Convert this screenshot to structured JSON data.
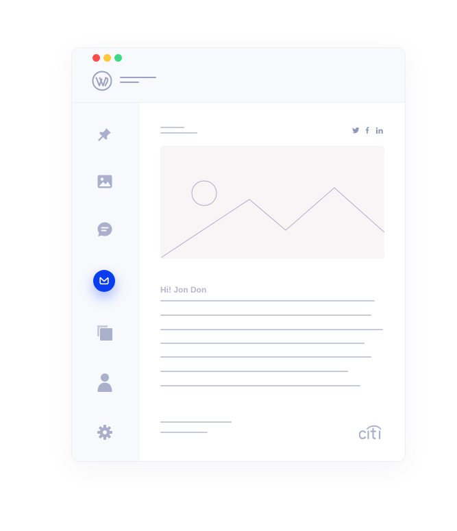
{
  "window": {
    "controls": [
      {
        "name": "close",
        "color": "#ff4d4d"
      },
      {
        "name": "minimize",
        "color": "#ffc83d"
      },
      {
        "name": "maximize",
        "color": "#3ddc84"
      }
    ],
    "logo_icon": "wordpress-logo-icon"
  },
  "sidebar": {
    "items": [
      {
        "icon": "pin-icon",
        "active": false
      },
      {
        "icon": "image-icon",
        "active": false
      },
      {
        "icon": "comment-icon",
        "active": false
      },
      {
        "icon": "mail-icon",
        "active": true
      },
      {
        "icon": "pages-icon",
        "active": false
      },
      {
        "icon": "user-icon",
        "active": false
      },
      {
        "icon": "gear-icon",
        "active": false
      }
    ],
    "active_color": "#0a3df0"
  },
  "email": {
    "social_icons": [
      "twitter-icon",
      "facebook-icon",
      "linkedin-icon"
    ],
    "hero_icon": "mountain-placeholder-icon",
    "greeting": "Hi! Jon Don",
    "brand_logo": "citi-logo"
  },
  "colors": {
    "placeholder_line": "#c6cadb",
    "icon": "#aab0cc",
    "background": "#f8f9fd"
  }
}
